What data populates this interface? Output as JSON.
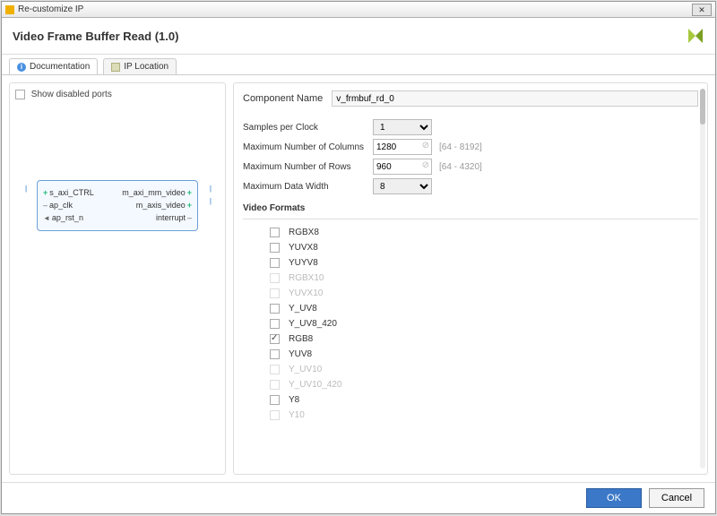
{
  "window": {
    "title": "Re-customize IP"
  },
  "header": {
    "title": "Video Frame Buffer Read (1.0)"
  },
  "tabs": {
    "documentation": "Documentation",
    "ip_location": "IP Location"
  },
  "left": {
    "show_disabled_ports": "Show disabled ports",
    "ports": {
      "s_axi_ctrl": "s_axi_CTRL",
      "ap_clk": "ap_clk",
      "ap_rst_n": "ap_rst_n",
      "m_axi_mm_video": "m_axi_mm_video",
      "m_axis_video": "m_axis_video",
      "interrupt": "interrupt"
    }
  },
  "form": {
    "component_name_label": "Component Name",
    "component_name_value": "v_frmbuf_rd_0",
    "samples_per_clock_label": "Samples per Clock",
    "samples_per_clock_value": "1",
    "max_cols_label": "Maximum Number of Columns",
    "max_cols_value": "1280",
    "max_cols_hint": "[64 - 8192]",
    "max_rows_label": "Maximum Number of Rows",
    "max_rows_value": "960",
    "max_rows_hint": "[64 - 4320]",
    "max_data_width_label": "Maximum Data Width",
    "max_data_width_value": "8",
    "video_formats_label": "Video Formats",
    "formats": [
      {
        "name": "RGBX8",
        "checked": false,
        "enabled": true
      },
      {
        "name": "YUVX8",
        "checked": false,
        "enabled": true
      },
      {
        "name": "YUYV8",
        "checked": false,
        "enabled": true
      },
      {
        "name": "RGBX10",
        "checked": false,
        "enabled": false
      },
      {
        "name": "YUVX10",
        "checked": false,
        "enabled": false
      },
      {
        "name": "Y_UV8",
        "checked": false,
        "enabled": true
      },
      {
        "name": "Y_UV8_420",
        "checked": false,
        "enabled": true
      },
      {
        "name": "RGB8",
        "checked": true,
        "enabled": true
      },
      {
        "name": "YUV8",
        "checked": false,
        "enabled": true
      },
      {
        "name": "Y_UV10",
        "checked": false,
        "enabled": false
      },
      {
        "name": "Y_UV10_420",
        "checked": false,
        "enabled": false
      },
      {
        "name": "Y8",
        "checked": false,
        "enabled": true
      },
      {
        "name": "Y10",
        "checked": false,
        "enabled": false
      }
    ]
  },
  "footer": {
    "ok": "OK",
    "cancel": "Cancel"
  }
}
